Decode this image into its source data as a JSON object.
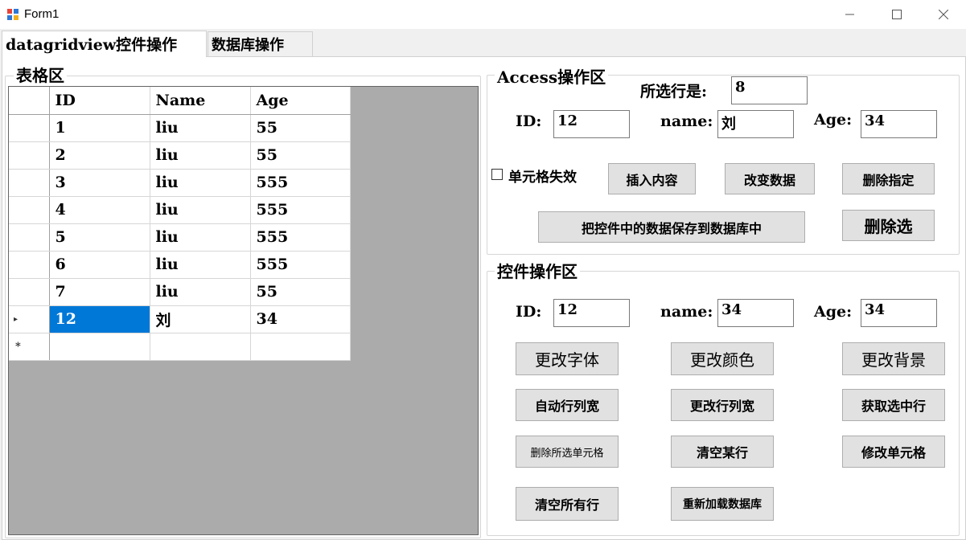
{
  "window": {
    "title": "Form1"
  },
  "tabs": [
    {
      "label": "datagridview控件操作"
    },
    {
      "label": "数据库操作"
    }
  ],
  "grid_group": {
    "title": "表格区"
  },
  "grid": {
    "columns": [
      "ID",
      "Name",
      "Age"
    ],
    "rows": [
      [
        "1",
        "liu",
        "55"
      ],
      [
        "2",
        "liu",
        "55"
      ],
      [
        "3",
        "liu",
        "555"
      ],
      [
        "4",
        "liu",
        "555"
      ],
      [
        "5",
        "liu",
        "555"
      ],
      [
        "6",
        "liu",
        "555"
      ],
      [
        "7",
        "liu",
        "55"
      ],
      [
        "12",
        "刘",
        "34"
      ]
    ],
    "current_row_marker": "▸",
    "new_row_marker": "*"
  },
  "access": {
    "title": "Access操作区",
    "selected_label": "所选行是:",
    "selected_value": "8",
    "id_label": "ID:",
    "id_value": "12",
    "name_label": "name:",
    "name_value": "刘",
    "age_label": "Age:",
    "age_value": "34",
    "disable_cell_label": "单元格失效",
    "insert_button": "插入内容",
    "change_button": "改变数据",
    "delete_specified_button": "删除指定",
    "save_button": "把控件中的数据保存到数据库中",
    "delete_selected_button": "删除选"
  },
  "control": {
    "title": "控件操作区",
    "id_label": "ID:",
    "id_value": "12",
    "name_label": "name:",
    "name_value": "34",
    "age_label": "Age:",
    "age_value": "34",
    "buttons": {
      "change_font": "更改字体",
      "change_color": "更改颜色",
      "change_background": "更改背景",
      "auto_size": "自动行列宽",
      "change_size": "更改行列宽",
      "get_selected_row": "获取选中行",
      "delete_selected_cells": "删除所选单元格",
      "clear_row": "清空某行",
      "modify_cell": "修改单元格",
      "clear_all_rows": "清空所有行",
      "reload_db": "重新加载数据库"
    }
  },
  "colors": {
    "selection": "#0078d7",
    "grid_background": "#ababab",
    "button": "#e1e1e1"
  }
}
